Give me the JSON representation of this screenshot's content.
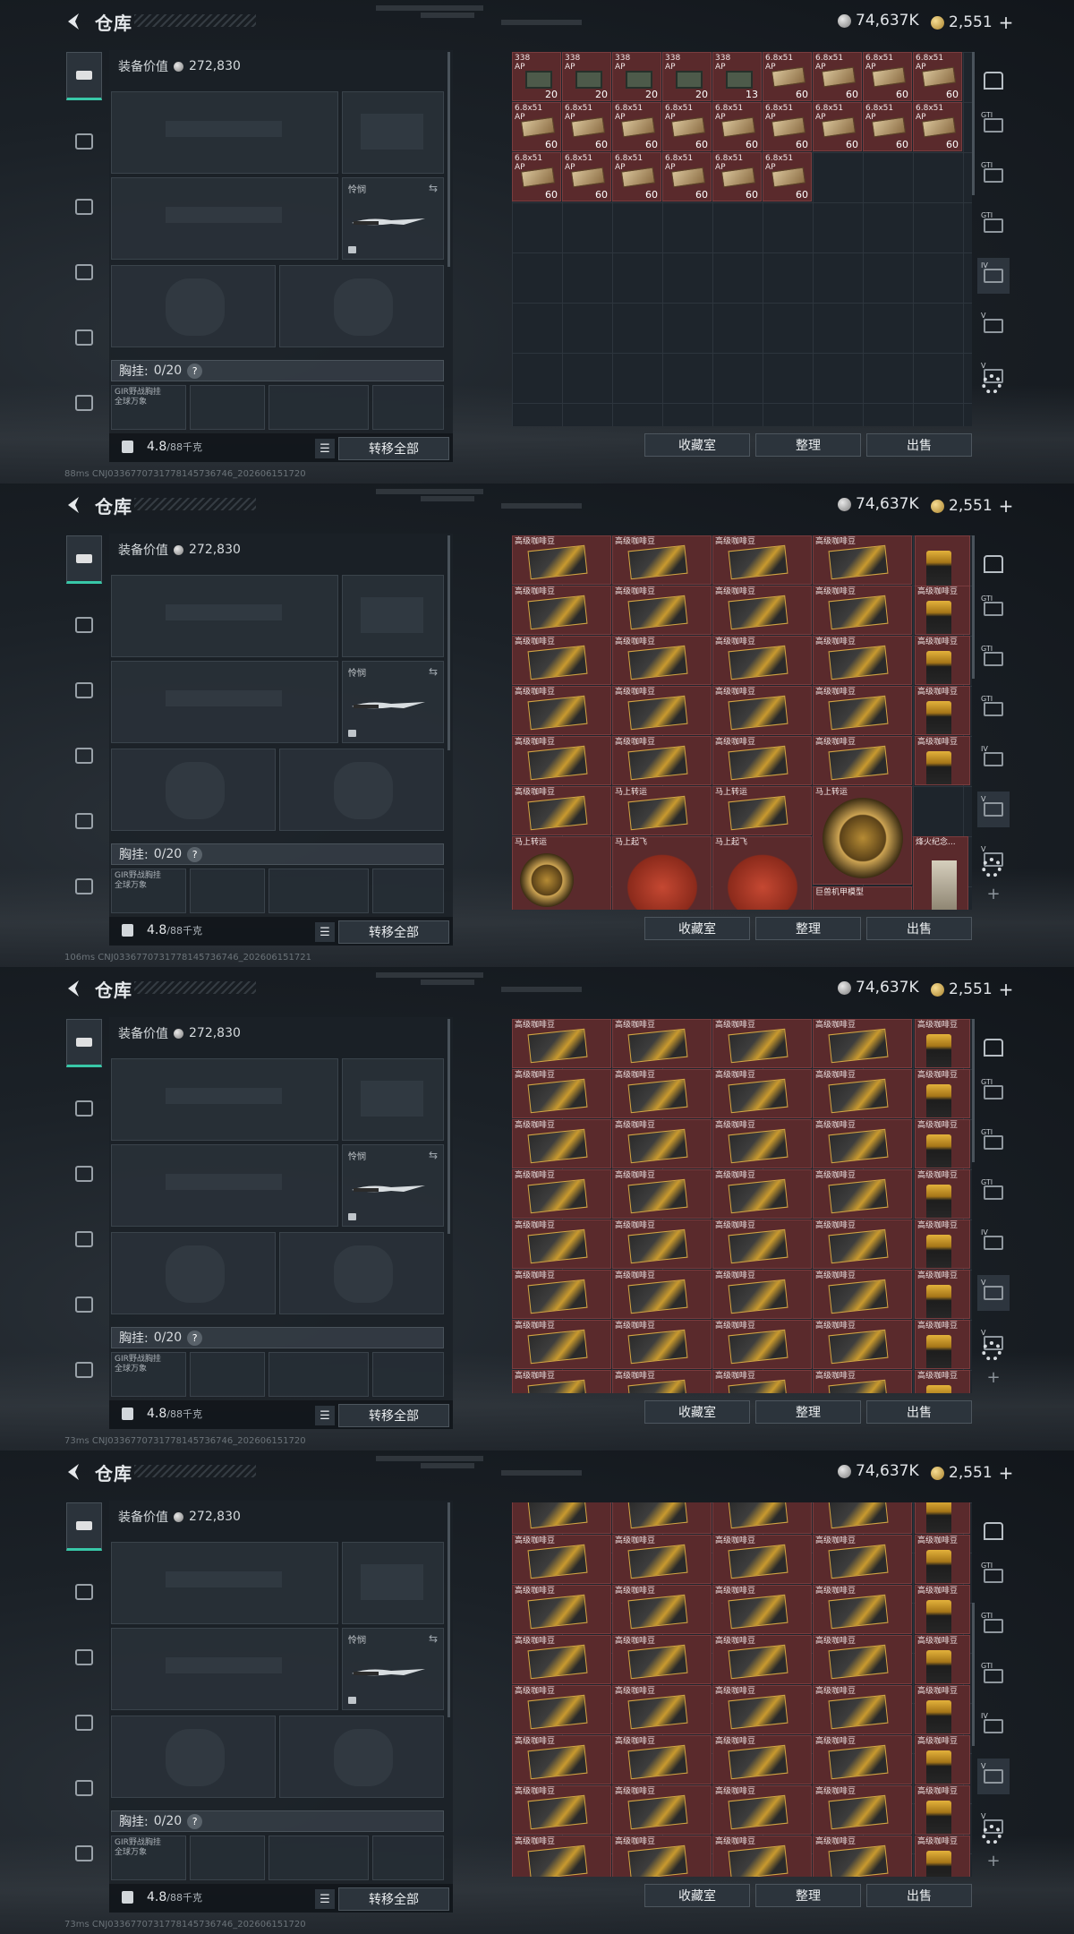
{
  "page": {
    "title": "仓库",
    "currency_silver": "74,637K",
    "currency_gold": "2,551",
    "plus_symbol": "+"
  },
  "loadout": {
    "value_label": "装备价值",
    "value": "272,830",
    "knife_label": "怜悯",
    "chest_label": "胸挂:",
    "chest_count": "0/20",
    "chest_rig_line1": "GIR野战胸挂",
    "chest_rig_line2": "全球万象",
    "weight_value": "4.8",
    "weight_unit": "/88千克",
    "transfer_label": "转移全部",
    "help_symbol": "?"
  },
  "stash_buttons": {
    "collection": "收藏室",
    "sort": "整理",
    "sell": "出售"
  },
  "screens": [
    {
      "signal": "88ms",
      "id_text": "CNJ0336770731778145736746_202606151720",
      "items": [
        {
          "name": "338",
          "name2": "AP",
          "qty": "20",
          "kind": "ammo338"
        },
        {
          "name": "338",
          "name2": "AP",
          "qty": "20",
          "kind": "ammo338"
        },
        {
          "name": "338",
          "name2": "AP",
          "qty": "20",
          "kind": "ammo338"
        },
        {
          "name": "338",
          "name2": "AP",
          "qty": "20",
          "kind": "ammo338"
        },
        {
          "name": "338",
          "name2": "AP",
          "qty": "13",
          "kind": "ammo338"
        },
        {
          "name": "6.8x51",
          "name2": "AP",
          "qty": "60",
          "kind": "ammo68"
        },
        {
          "name": "6.8x51",
          "name2": "AP",
          "qty": "60",
          "kind": "ammo68"
        },
        {
          "name": "6.8x51",
          "name2": "AP",
          "qty": "60",
          "kind": "ammo68"
        },
        {
          "name": "6.8x51",
          "name2": "AP",
          "qty": "60",
          "kind": "ammo68"
        },
        {
          "name": "6.8x51",
          "name2": "AP",
          "qty": "60",
          "kind": "ammo68"
        },
        {
          "name": "6.8x51",
          "name2": "AP",
          "qty": "60",
          "kind": "ammo68"
        },
        {
          "name": "6.8x51",
          "name2": "AP",
          "qty": "60",
          "kind": "ammo68"
        },
        {
          "name": "6.8x51",
          "name2": "AP",
          "qty": "60",
          "kind": "ammo68"
        },
        {
          "name": "6.8x51",
          "name2": "AP",
          "qty": "60",
          "kind": "ammo68"
        },
        {
          "name": "6.8x51",
          "name2": "AP",
          "qty": "60",
          "kind": "ammo68"
        },
        {
          "name": "6.8x51",
          "name2": "AP",
          "qty": "60",
          "kind": "ammo68"
        },
        {
          "name": "6.8x51",
          "name2": "AP",
          "qty": "60",
          "kind": "ammo68"
        },
        {
          "name": "6.8x51",
          "name2": "AP",
          "qty": "60",
          "kind": "ammo68"
        },
        {
          "name": "6.8x51",
          "name2": "AP",
          "qty": "60",
          "kind": "ammo68"
        },
        {
          "name": "6.8x51",
          "name2": "AP",
          "qty": "60",
          "kind": "ammo68"
        },
        {
          "name": "6.8x51",
          "name2": "AP",
          "qty": "60",
          "kind": "ammo68"
        },
        {
          "name": "6.8x51",
          "name2": "AP",
          "qty": "60",
          "kind": "ammo68"
        },
        {
          "name": "6.8x51",
          "name2": "AP",
          "qty": "60",
          "kind": "ammo68"
        },
        {
          "name": "6.8x51",
          "name2": "AP",
          "qty": "60",
          "kind": "ammo68"
        }
      ]
    },
    {
      "signal": "106ms",
      "id_text": "CNJ0336770731778145736746_202606151721",
      "items": [
        {
          "name": "高级咖啡豆",
          "kind": "coffee"
        },
        {
          "name": "高级咖啡豆",
          "kind": "coffee"
        },
        {
          "name": "高级咖啡豆",
          "kind": "coffee"
        },
        {
          "name": "高级咖啡豆",
          "kind": "coffee"
        },
        {
          "name": "",
          "kind": "bag"
        },
        {
          "name": "高级咖啡豆",
          "kind": "coffee"
        },
        {
          "name": "高级咖啡豆",
          "kind": "coffee"
        },
        {
          "name": "高级咖啡豆",
          "kind": "coffee"
        },
        {
          "name": "高级咖啡豆",
          "kind": "coffee"
        },
        {
          "name": "高级咖啡豆",
          "kind": "bag"
        },
        {
          "name": "高级咖啡豆",
          "kind": "coffee"
        },
        {
          "name": "高级咖啡豆",
          "kind": "coffee"
        },
        {
          "name": "高级咖啡豆",
          "kind": "coffee"
        },
        {
          "name": "高级咖啡豆",
          "kind": "coffee"
        },
        {
          "name": "高级咖啡豆",
          "kind": "coffee"
        },
        {
          "name": "高级咖啡豆",
          "kind": "coffee"
        },
        {
          "name": "高级咖啡豆",
          "kind": "coffee"
        },
        {
          "name": "高级咖啡豆",
          "kind": "coffee"
        },
        {
          "name": "高级咖啡豆",
          "kind": "coffee"
        },
        {
          "name": "高级咖啡豆",
          "kind": "coffee"
        },
        {
          "name": "高级咖啡豆",
          "kind": "coffee"
        },
        {
          "name": "高级咖啡豆",
          "kind": "coffee"
        },
        {
          "name": "高级咖啡豆",
          "kind": "bag"
        },
        {
          "name": "高级咖啡豆",
          "kind": "coffee"
        },
        {
          "name": "高级咖啡豆",
          "kind": "coffee"
        },
        {
          "name": "高级咖啡豆",
          "kind": "coffee"
        },
        {
          "name": "马上转运",
          "kind": "wheel"
        },
        {
          "name": "马上转运",
          "kind": "wheel"
        },
        {
          "name": "马上起飞",
          "kind": "horse"
        },
        {
          "name": "马上起飞",
          "kind": "horse"
        },
        {
          "name": "巨兽机甲模型",
          "kind": "blank"
        },
        {
          "name": "烽火纪念...",
          "kind": "monument"
        }
      ]
    },
    {
      "signal": "73ms",
      "id_text": "CNJ0336770731778145736746_202606151720",
      "items_label": "高级咖啡豆"
    },
    {
      "signal": "73ms",
      "id_text": "CNJ0336770731778145736746_202606151720",
      "items_label": "高级咖啡豆"
    }
  ],
  "right_nav": {
    "labels": [
      "GTI",
      "GTI",
      "GTI",
      "IV",
      "V",
      "V"
    ]
  }
}
